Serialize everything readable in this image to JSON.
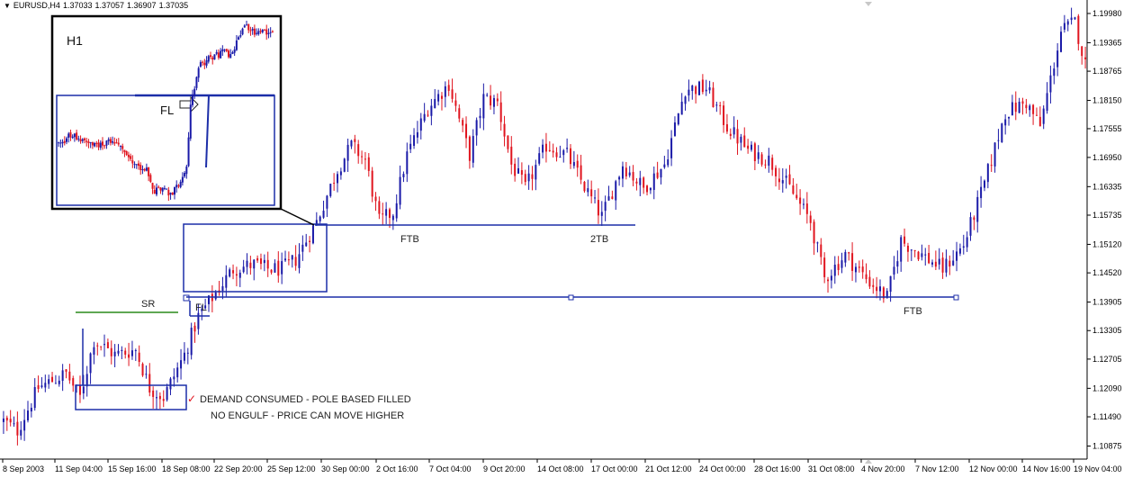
{
  "header": {
    "symbol": "EURUSD,H4",
    "open": "1.37033",
    "high": "1.37057",
    "low": "1.36907",
    "close": "1.37035"
  },
  "colors": {
    "bull": "#1a1aa8",
    "bear": "#e0141e",
    "zone": "#1c2ea8",
    "sr_line": "#2a8a1a",
    "inset_border": "#000000",
    "check": "#e0141e"
  },
  "chart_data": {
    "type": "candlestick",
    "y_ticks": [
      "1.19980",
      "1.19365",
      "1.18765",
      "1.18150",
      "1.17555",
      "1.16950",
      "1.16335",
      "1.15735",
      "1.15120",
      "1.14520",
      "1.13905",
      "1.13305",
      "1.12705",
      "1.12090",
      "1.11490",
      "1.10875"
    ],
    "x_ticks": [
      "8 Sep 2003",
      "11 Sep 04:00",
      "15 Sep 16:00",
      "18 Sep 08:00",
      "22 Sep 20:00",
      "25 Sep 12:00",
      "30 Sep 00:00",
      "2 Oct 16:00",
      "7 Oct 04:00",
      "9 Oct 20:00",
      "14 Oct 08:00",
      "17 Oct 00:00",
      "21 Oct 12:00",
      "24 Oct 00:00",
      "28 Oct 16:00",
      "31 Oct 08:00",
      "4 Nov 20:00",
      "7 Nov 12:00",
      "12 Nov 00:00",
      "14 Nov 16:00",
      "19 Nov 04:00"
    ],
    "ylim": [
      1.106,
      1.2015
    ],
    "price_path": [
      [
        0,
        1.114
      ],
      [
        4,
        1.112
      ],
      [
        10,
        1.121
      ],
      [
        18,
        1.124
      ],
      [
        22,
        1.119
      ],
      [
        26,
        1.131
      ],
      [
        32,
        1.128
      ],
      [
        38,
        1.129
      ],
      [
        42,
        1.121
      ],
      [
        46,
        1.119
      ],
      [
        52,
        1.128
      ],
      [
        56,
        1.136
      ],
      [
        62,
        1.142
      ],
      [
        66,
        1.146
      ],
      [
        72,
        1.147
      ],
      [
        76,
        1.146
      ],
      [
        80,
        1.146
      ],
      [
        84,
        1.148
      ],
      [
        90,
        1.156
      ],
      [
        96,
        1.167
      ],
      [
        100,
        1.172
      ],
      [
        104,
        1.169
      ],
      [
        108,
        1.156
      ],
      [
        112,
        1.158
      ],
      [
        116,
        1.17
      ],
      [
        122,
        1.18
      ],
      [
        128,
        1.185
      ],
      [
        134,
        1.17
      ],
      [
        138,
        1.182
      ],
      [
        142,
        1.181
      ],
      [
        146,
        1.168
      ],
      [
        150,
        1.163
      ],
      [
        156,
        1.172
      ],
      [
        162,
        1.17
      ],
      [
        168,
        1.162
      ],
      [
        172,
        1.157
      ],
      [
        178,
        1.168
      ],
      [
        184,
        1.163
      ],
      [
        190,
        1.168
      ],
      [
        196,
        1.184
      ],
      [
        202,
        1.184
      ],
      [
        208,
        1.176
      ],
      [
        214,
        1.171
      ],
      [
        220,
        1.169
      ],
      [
        226,
        1.163
      ],
      [
        232,
        1.156
      ],
      [
        236,
        1.144
      ],
      [
        242,
        1.149
      ],
      [
        248,
        1.144
      ],
      [
        254,
        1.14
      ],
      [
        258,
        1.152
      ],
      [
        264,
        1.149
      ],
      [
        270,
        1.146
      ],
      [
        276,
        1.151
      ],
      [
        282,
        1.164
      ],
      [
        288,
        1.179
      ],
      [
        294,
        1.181
      ],
      [
        298,
        1.176
      ],
      [
        304,
        1.196
      ],
      [
        308,
        1.198
      ],
      [
        311,
        1.189
      ]
    ],
    "annotations": {
      "sr": "SR",
      "fl_main": "FL",
      "ftb1": "FTB",
      "ftb2": "2TB",
      "ftb3": "FTB",
      "demand_line1": "DEMAND CONSUMED - POLE BASED FILLED",
      "demand_line2": "NO ENGULF - PRICE CAN MOVE HIGHER",
      "check_mark": "✓"
    },
    "inset": {
      "title": "H1",
      "fl": "FL"
    }
  }
}
